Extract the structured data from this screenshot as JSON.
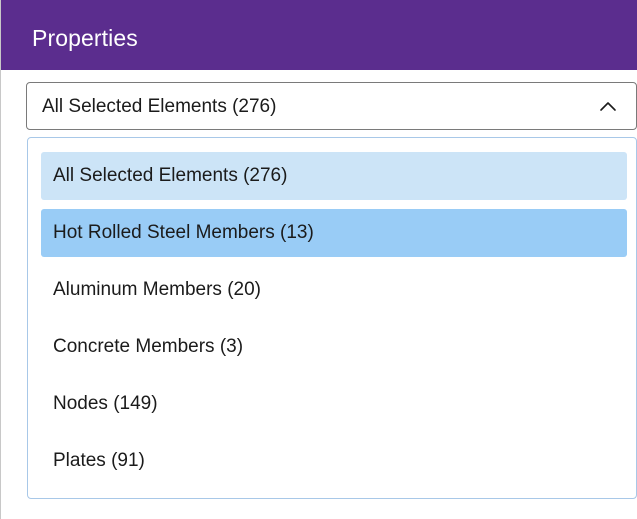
{
  "header": {
    "title": "Properties"
  },
  "select": {
    "value": "All Selected Elements (276)",
    "icon": "chevron-up-icon",
    "expanded": true
  },
  "dropdown": {
    "options": [
      {
        "label": "All Selected Elements (276)",
        "state": "selected"
      },
      {
        "label": "Hot Rolled Steel Members (13)",
        "state": "hovered"
      },
      {
        "label": "Aluminum Members (20)",
        "state": "normal"
      },
      {
        "label": "Concrete Members (3)",
        "state": "normal"
      },
      {
        "label": "Nodes (149)",
        "state": "normal"
      },
      {
        "label": "Plates (91)",
        "state": "normal"
      }
    ]
  },
  "colors": {
    "header_bg": "#5b2d8e",
    "selected_bg": "#cce4f7",
    "hover_bg": "#99ccf6",
    "dropdown_border": "#a8c8e8"
  }
}
